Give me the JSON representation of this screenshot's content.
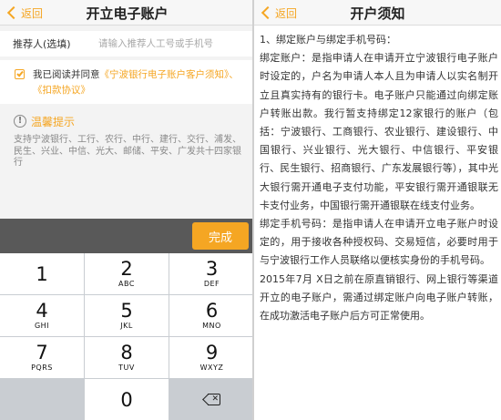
{
  "left": {
    "nav": {
      "back_label": "返回",
      "title": "开立电子账户"
    },
    "referrer": {
      "label": "推荐人(选填)",
      "placeholder": "请输入推荐人工号或手机号",
      "value": ""
    },
    "agreement": {
      "checked": true,
      "prefix": "我已阅读并同意",
      "link1": "《宁波银行电子账户客户须知》",
      "sep": "、",
      "link2": "《扣款协议》"
    },
    "tips": {
      "icon": "info-icon",
      "title": "温馨提示",
      "text": "支持宁波银行、工行、农行、中行、建行、交行、浦发、民生、兴业、中信、光大、邮储、平安、广发共十四家银行"
    },
    "toolbar": {
      "done_label": "完成"
    },
    "keypad": {
      "keys": [
        {
          "digit": "1",
          "letters": ""
        },
        {
          "digit": "2",
          "letters": "ABC"
        },
        {
          "digit": "3",
          "letters": "DEF"
        },
        {
          "digit": "4",
          "letters": "GHI"
        },
        {
          "digit": "5",
          "letters": "JKL"
        },
        {
          "digit": "6",
          "letters": "MNO"
        },
        {
          "digit": "7",
          "letters": "PQRS"
        },
        {
          "digit": "8",
          "letters": "TUV"
        },
        {
          "digit": "9",
          "letters": "WXYZ"
        },
        {
          "digit": "0",
          "letters": ""
        }
      ],
      "delete_icon": "backspace-icon"
    }
  },
  "right": {
    "nav": {
      "back_label": "返回",
      "title": "开户须知"
    },
    "paragraphs": [
      "1、绑定账户与绑定手机号码：",
      "绑定账户：是指申请人在申请开立宁波银行电子账户时设定的，户名为申请人本人且为申请人以实名制开立且真实持有的银行卡。电子账户只能通过向绑定账户转账出款。我行暂支持绑定12家银行的账户（包括：宁波银行、工商银行、农业银行、建设银行、中国银行、兴业银行、光大银行、中信银行、平安银行、民生银行、招商银行、广东发展银行等），其中光大银行需开通电子支付功能，平安银行需开通银联无卡支付业务，中国银行需开通银联在线支付业务。",
      "绑定手机号码：是指申请人在申请开立电子账户时设定的，用于接收各种授权码、交易短信，必要时用于与宁波银行工作人员联络以便核实身份的手机号码。",
      "2015年7月 X日之前在原直销银行、网上银行等渠道开立的电子账户，需通过绑定账户向电子账户转账，在成功激活电子账户后方可正常使用。"
    ]
  },
  "colors": {
    "accent": "#f5a623",
    "toolbar": "#595959",
    "keypad_bg": "#c9cdd2"
  }
}
